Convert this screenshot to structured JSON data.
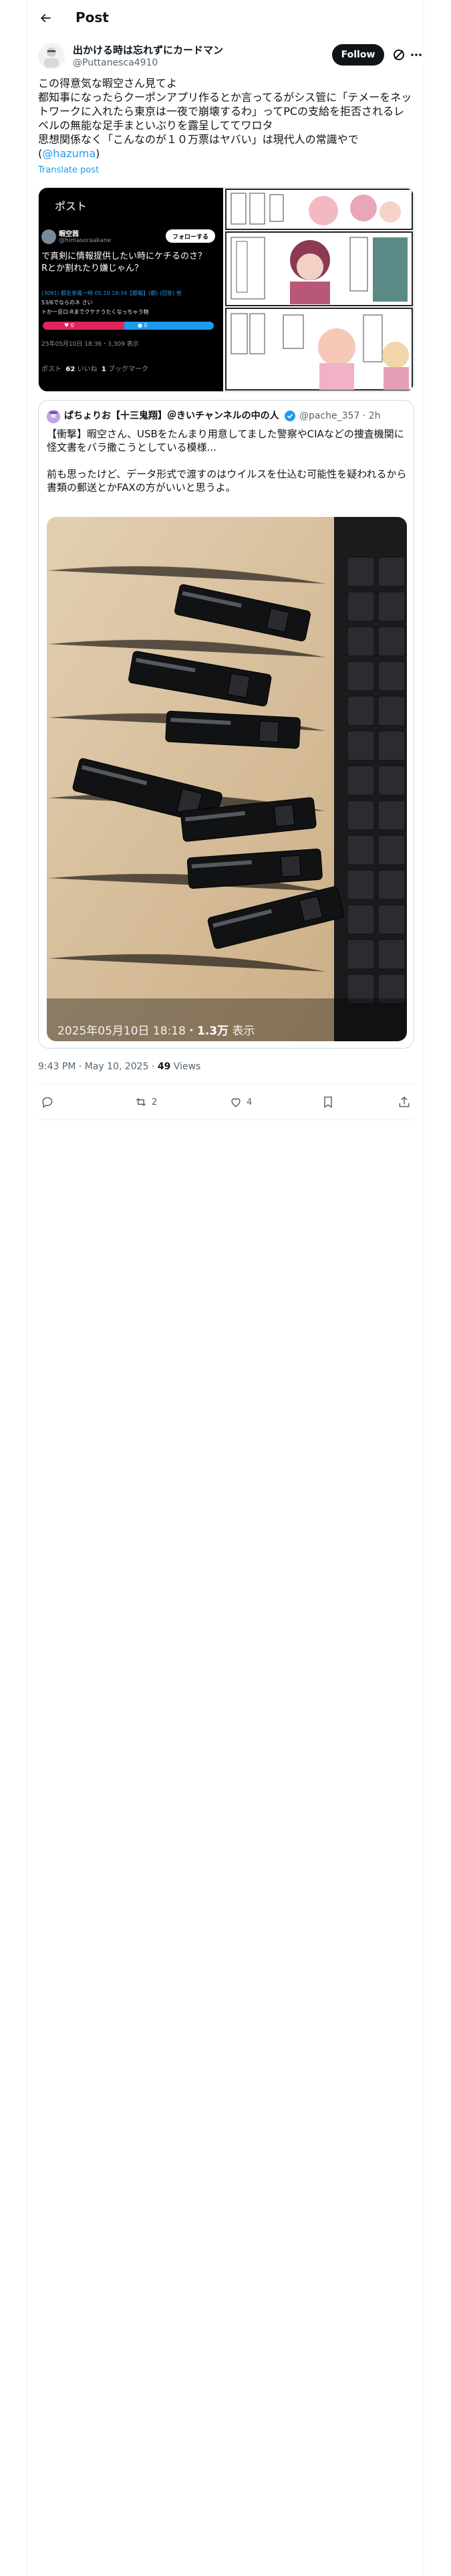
{
  "header": {
    "title": "Post"
  },
  "author": {
    "name": "出かける時は忘れずにカードマン",
    "handle": "@Puttanesca4910",
    "follow_label": "Follow"
  },
  "tweet": {
    "text_before": "この得意気な暇空さん見てよ\n都知事になったらクーポンアプリ作るとか言ってるがシス管に「テメーをネットワークに入れたら東京は一夜で崩壊するわ」ってPCの支給を拒否されるレベルの無能な足手まといぶりを露呈しててワロタ\n思想関係なく「こんなのが１０万票はヤバい」は現代人の常識やで(",
    "mention": "@hazuma",
    "text_after": ")",
    "translate_label": "Translate post"
  },
  "embedded_screenshot": {
    "title": "ポスト",
    "name": "暇空茜",
    "handle": "@himasoraakane",
    "follow_label": "フォローする",
    "text": "で真剣に情報提供したい時にケチるのさ？\nRとか割れたり嫌じゃん？",
    "meta": "(3091) 都名参風一時 05.10 18:34【都報】(都) (回答) 他",
    "line1": "53/6でならのネ さい",
    "line2": "トか一旦ロ-Rまでクケナうたくなっちゃう物",
    "vote_left": "0",
    "vote_right": "0",
    "date": "25年05月10日 18:36・3,309 表示",
    "stats_prefix": "ポスト",
    "stats_likes": "62",
    "stats_likes_label": "いいね",
    "stats_bookmarks": "1",
    "stats_bookmarks_label": "ブックマーク"
  },
  "quote": {
    "name": "ぱちょりお【十三鬼翔】＠きいチャンネルの中の人",
    "handle": "@pache_357 · 2h",
    "text": "【衝撃】暇空さん、USBをたんまり用意してました警察やCIAなどの捜査機関に怪文書をバラ撒こうとしている模様...\n\n前も思ったけど、データ形式で渡すのはウイルスを仕込む可能性を疑われるから書類の郵送とかFAXの方がいいと思うよ。",
    "photo_caption_date": "2025年05月10日 18:18",
    "photo_caption_views": "1.3万",
    "photo_caption_suffix": "表示"
  },
  "timestamp": {
    "time": "9:43 PM · May 10, 2025 · ",
    "views": "49",
    "views_label": " Views"
  },
  "actions": {
    "reply_count": "",
    "repost_count": "2",
    "like_count": "4"
  },
  "colors": {
    "accent": "#1d9bf0",
    "text": "#0f1419",
    "secondary": "#536471",
    "border": "#eff3f4"
  }
}
